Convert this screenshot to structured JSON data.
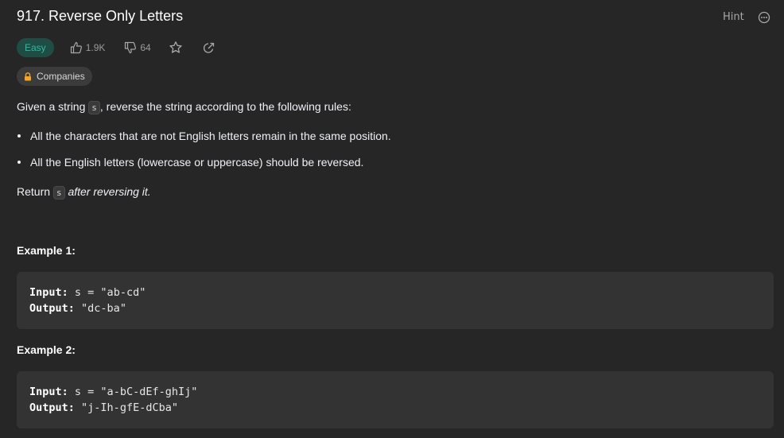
{
  "problem": {
    "title": "917. Reverse Only Letters",
    "hint_label": "Hint",
    "difficulty": "Easy",
    "likes": "1.9K",
    "dislikes": "64",
    "companies_label": "Companies"
  },
  "description": {
    "intro_prefix": "Given a string ",
    "intro_code": "s",
    "intro_suffix": ", reverse the string according to the following rules:",
    "rules": [
      "All the characters that are not English letters remain in the same position.",
      "All the English letters (lowercase or uppercase) should be reversed."
    ],
    "return_prefix": "Return ",
    "return_code": "s",
    "return_suffix": "after reversing it."
  },
  "examples": [
    {
      "title": "Example 1:",
      "input_label": "Input:",
      "input_value": "s = \"ab-cd\"",
      "output_label": "Output:",
      "output_value": "\"dc-ba\""
    },
    {
      "title": "Example 2:",
      "input_label": "Input:",
      "input_value": "s = \"a-bC-dEf-ghIj\"",
      "output_label": "Output:",
      "output_value": "\"j-Ih-gfE-dCba\""
    }
  ],
  "colors": {
    "background": "#262626",
    "easy_text": "#2cbb9c",
    "easy_bg": "#1f4d45",
    "lock": "#f5a623"
  }
}
